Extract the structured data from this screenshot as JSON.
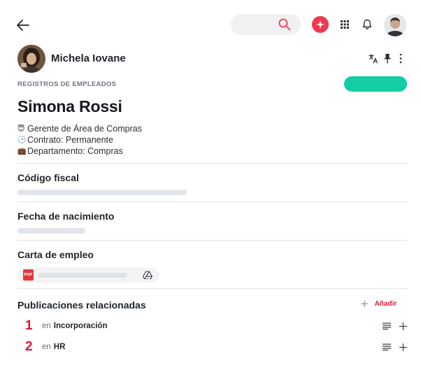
{
  "header": {
    "back_icon": "arrow-left-icon",
    "search_icon": "search-icon",
    "ai_icon": "sparkle-icon",
    "apps_icon": "grid-icon",
    "notifications_icon": "bell-icon",
    "user_avatar": "avatar"
  },
  "author": {
    "name": "Michela Iovane"
  },
  "toolbar": {
    "icons": [
      "translate-icon",
      "pin-icon",
      "more-vertical-icon"
    ]
  },
  "record": {
    "category": "REGISTROS DE EMPLEADOS",
    "title": "Simona Rossi",
    "details": [
      {
        "emoji": "😇",
        "text": "Gerente de Área de Compras"
      },
      {
        "emoji": "🕒",
        "text": "Contrato: Permanente"
      },
      {
        "emoji": "💼",
        "text": "Departamento: Compras"
      }
    ]
  },
  "fields": {
    "tax_code_label": "Código fiscal",
    "birth_date_label": "Fecha de nacimiento",
    "employment_letter_label": "Carta de empleo",
    "file_badge": "PDF"
  },
  "publications": {
    "title": "Publicaciones relacionadas",
    "add_label": "Añadir",
    "items": [
      {
        "number": "1",
        "prefix": "en",
        "name": "Incorporación"
      },
      {
        "number": "2",
        "prefix": "en",
        "name": "HR"
      }
    ]
  },
  "colors": {
    "accent": "#d81b3c",
    "status": "#14cda4",
    "ai": "#f0384e"
  }
}
